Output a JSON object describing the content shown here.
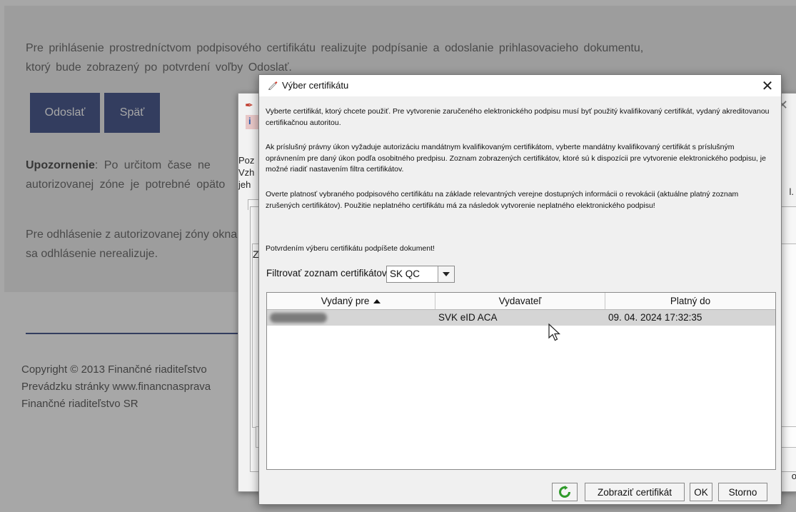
{
  "web": {
    "intro": "Pre prihlásenie prostredníctvom podpisového certifikátu realizujte podpísanie a odoslanie prihlasovacieho dokumentu, ktorý bude zobrazený po potvrdení voľby Odoslať.",
    "send_button": "Odoslať",
    "back_button": "Späť",
    "warning_bold": "Upozornenie",
    "warning_rest": ": Po určitom čase ne autorizovanej zóne je potrebné opäto",
    "logout_text": "Pre odhlásenie z autorizovanej zóny okna sa odhlásenie nerealizuje.",
    "footer": [
      "Copyright © 2013 Finančné riaditeľstvo",
      "Prevádzku stránky www.financnasprava",
      "Finančné riaditeľstvo SR"
    ]
  },
  "rear_dialog": {
    "lines": [
      "Poz",
      "Vzh",
      "jeh"
    ],
    "right_text": "l.",
    "tab_letter": "Z",
    "field_letter": "Z",
    "bottom_right": "o"
  },
  "dialog": {
    "title": "Výber certifikátu",
    "close_label": "✕",
    "paragraphs": [
      "Vyberte certifikát, ktorý chcete použiť. Pre vytvorenie zaručeného elektronického podpisu musí byť použitý kvalifikovaný certifikát, vydaný akreditovanou certifikačnou autoritou.",
      "Ak príslušný právny úkon vyžaduje autorizáciu mandátnym kvalifikovaným certifikátom, vyberte mandátny kvalifikovaný certifikát s príslušným oprávnením pre daný úkon podľa osobitného predpisu. Zoznam zobrazených certifikátov, ktoré sú k dispozícii pre vytvorenie elektronického podpisu, je možné riadiť nastavením filtra certifikátov.",
      "Overte platnosť vybraného podpisového certifikátu na základe relevantných verejne dostupných informácii o revokácii (aktuálne platný zoznam zrušených certifikátov). Použitie neplatného certifikátu má za následok vytvorenie neplatného elektronického podpisu!",
      "Potvrdením výberu certifikátu podpíšete dokument!"
    ],
    "filter_label": "Filtrovať zoznam certifikátov:",
    "filter_value": "SK QC",
    "table": {
      "columns": [
        "Vydaný pre",
        "Vydavateľ",
        "Platný do"
      ],
      "rows": [
        {
          "issuer": "SVK eID ACA",
          "valid_to": "09. 04. 2024 17:32:35"
        }
      ]
    },
    "buttons": {
      "show_cert": "Zobraziť certifikát",
      "ok": "OK",
      "cancel": "Storno"
    }
  }
}
